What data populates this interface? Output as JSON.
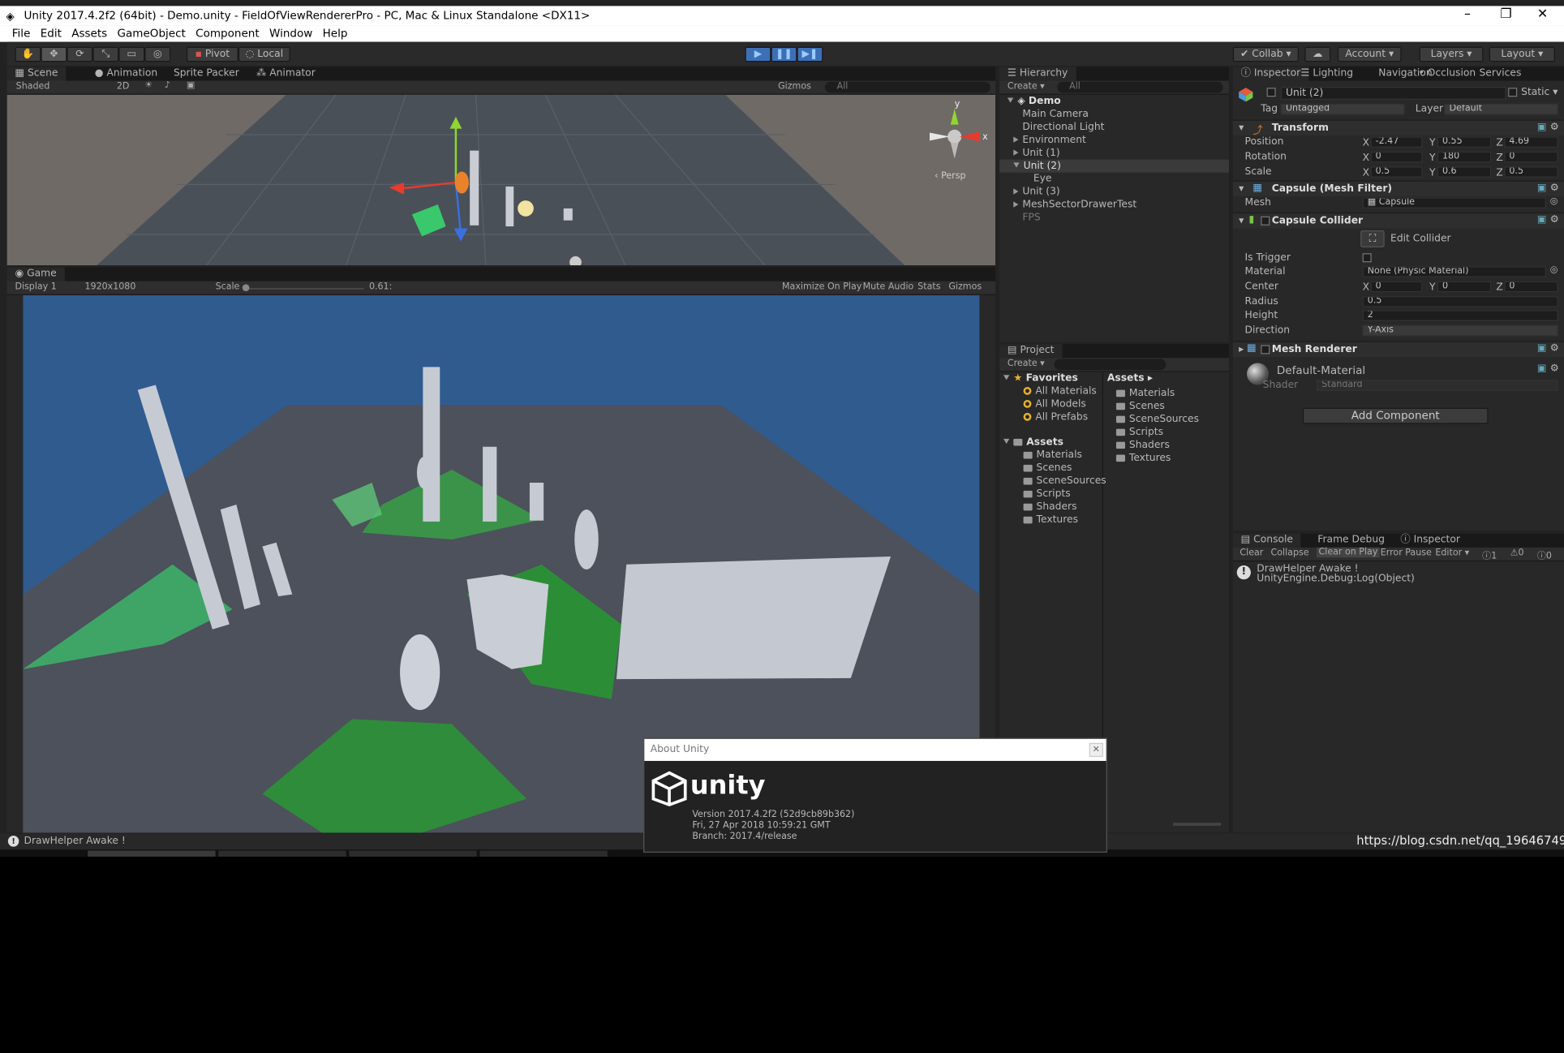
{
  "window": {
    "title": "Unity 2017.4.2f2 (64bit) - Demo.unity - FieldOfViewRendererPro - PC, Mac & Linux Standalone <DX11>",
    "min": "–",
    "max": "❐",
    "close": "✕"
  },
  "menu": [
    "File",
    "Edit",
    "Assets",
    "GameObject",
    "Component",
    "Window",
    "Help"
  ],
  "toolbar": {
    "pivot": "Pivot",
    "local": "Local",
    "collab": "Collab",
    "account": "Account",
    "layers": "Layers",
    "layout": "Layout"
  },
  "scene_tabs": {
    "scene": "Scene",
    "animation": "Animation",
    "sprite_packer": "Sprite Packer",
    "animator": "Animator"
  },
  "scene_bar": {
    "shaded": "Shaded",
    "mode2d": "2D",
    "gizmos": "Gizmos",
    "search": "All",
    "persp": "Persp"
  },
  "game": {
    "tab": "Game",
    "display": "Display 1",
    "resolution": "1920x1080",
    "scale_label": "Scale",
    "scale_value": "0.61:",
    "maximize": "Maximize On Play",
    "mute": "Mute Audio",
    "stats": "Stats",
    "gizmos": "Gizmos"
  },
  "hierarchy": {
    "tab": "Hierarchy",
    "create": "Create",
    "search": "All",
    "root": "Demo",
    "items": [
      "Main Camera",
      "Directional Light",
      "Environment",
      "Unit (1)",
      "Unit (2)",
      "Eye",
      "Unit (3)",
      "MeshSectorDrawerTest",
      "FPS"
    ]
  },
  "project": {
    "tab": "Project",
    "create": "Create",
    "favorites": "Favorites",
    "fav_items": [
      "All Materials",
      "All Models",
      "All Prefabs"
    ],
    "assets": "Assets",
    "asset_items": [
      "Materials",
      "Scenes",
      "SceneSources",
      "Scripts",
      "Shaders",
      "Textures"
    ],
    "assets_crumb": "Assets ▸",
    "right_items": [
      "Materials",
      "Scenes",
      "SceneSources",
      "Scripts",
      "Shaders",
      "Textures"
    ]
  },
  "inspector": {
    "tabs": [
      "Inspector",
      "Lighting",
      "Navigation",
      "Occlusion",
      "Services"
    ],
    "object_name": "Unit (2)",
    "static": "Static",
    "tag_label": "Tag",
    "tag": "Untagged",
    "layer_label": "Layer",
    "layer": "Default",
    "transform": {
      "title": "Transform",
      "position": [
        "-2.47",
        "0.55",
        "4.69"
      ],
      "rotation": [
        "0",
        "180",
        "0"
      ],
      "scale": [
        "0.5",
        "0.6",
        "0.5"
      ],
      "labels": [
        "Position",
        "Rotation",
        "Scale"
      ]
    },
    "mesh_filter": {
      "title": "Capsule (Mesh Filter)",
      "mesh_label": "Mesh",
      "mesh": "Capsule"
    },
    "collider": {
      "title": "Capsule Collider",
      "edit": "Edit Collider",
      "is_trigger": "Is Trigger",
      "material_label": "Material",
      "material": "None (Physic Material)",
      "center_label": "Center",
      "center": [
        "0",
        "0",
        "0"
      ],
      "radius_label": "Radius",
      "radius": "0.5",
      "height_label": "Height",
      "height": "2",
      "direction_label": "Direction",
      "direction": "Y-Axis"
    },
    "renderer": {
      "title": "Mesh Renderer",
      "material": "Default-Material",
      "shader_label": "Shader",
      "shader": "Standard"
    },
    "add_component": "Add Component"
  },
  "console": {
    "tabs": [
      "Console",
      "Frame Debug",
      "Inspector"
    ],
    "buttons": [
      "Clear",
      "Collapse",
      "Clear on Play",
      "Error Pause",
      "Editor"
    ],
    "counts": [
      "1",
      "0",
      "0"
    ],
    "message1": "DrawHelper Awake !",
    "message2": "UnityEngine.Debug:Log(Object)"
  },
  "status": {
    "message": "DrawHelper Awake !"
  },
  "about": {
    "title": "About Unity",
    "brand": "unity",
    "version": "Version 2017.4.2f2 (52d9cb89b362)",
    "date": "Fri, 27 Apr 2018 10:59:21 GMT",
    "branch": "Branch: 2017.4/release"
  },
  "watermark": "https://blog.csdn.net/qq_19646749",
  "colors": {
    "accent": "#3d6fb6",
    "green": "#1f8f2e",
    "sky": "#2f5b8f"
  }
}
